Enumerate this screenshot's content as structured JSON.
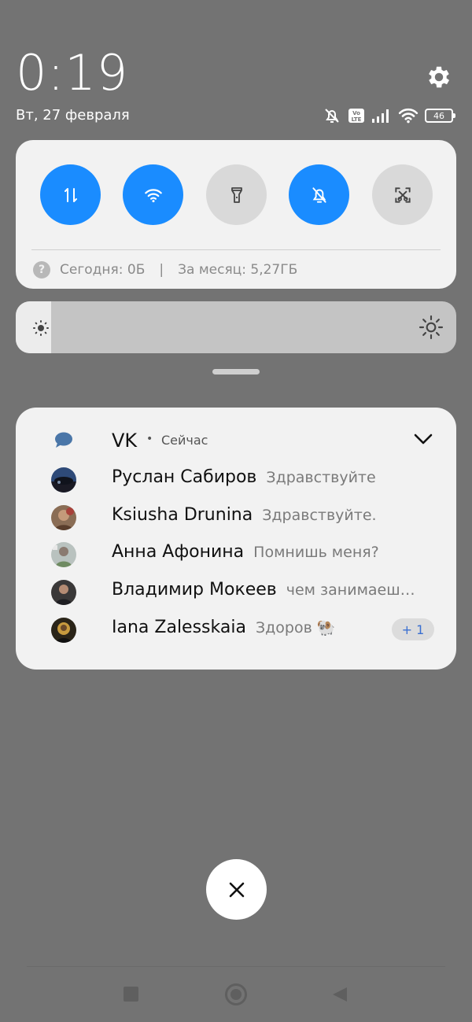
{
  "status_bar": {
    "time": "0:19",
    "date": "Вт, 27 февраля",
    "battery": "46",
    "icons": [
      "silent-mode-icon",
      "volte-icon",
      "signal-icon",
      "wifi-icon",
      "battery-icon"
    ]
  },
  "settings_icon": "gear-icon",
  "quick_settings": {
    "toggles": [
      {
        "name": "mobile-data",
        "icon": "data-transfer-icon",
        "state": "on"
      },
      {
        "name": "wifi",
        "icon": "wifi-icon",
        "state": "on"
      },
      {
        "name": "flashlight",
        "icon": "flashlight-icon",
        "state": "off"
      },
      {
        "name": "silent",
        "icon": "bell-off-icon",
        "state": "on"
      },
      {
        "name": "screenshot",
        "icon": "screenshot-icon",
        "state": "off"
      }
    ],
    "data_today": "Сегодня: 0Б",
    "data_separator": "|",
    "data_month": "За месяц: 5,27ГБ"
  },
  "brightness": {
    "level": 0.08
  },
  "notification": {
    "app_name": "VK",
    "dot": "•",
    "time": "Сейчас",
    "messages": [
      {
        "sender": "Руслан Сабиров",
        "text": "Здравствуйте"
      },
      {
        "sender": "Ksiusha Drunina",
        "text": "Здравствуйте."
      },
      {
        "sender": "Анна Афонина",
        "text": "Помнишь меня?"
      },
      {
        "sender": "Владимир Мокеев",
        "text": "чем занимаеш…"
      },
      {
        "sender": "Iana Zalesskaia",
        "text": "Здоров 🐏"
      }
    ],
    "more_count": "+ 1"
  },
  "colors": {
    "background": "#737373",
    "accent": "#1a8cff",
    "card": "#f2f2f2"
  }
}
